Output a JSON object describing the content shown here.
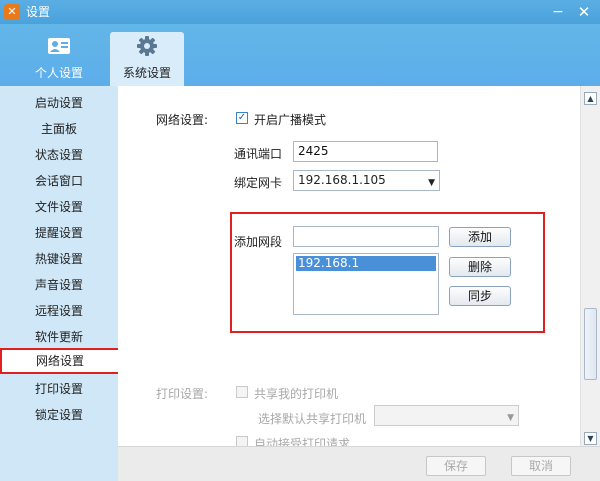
{
  "window": {
    "app_icon": "✕",
    "title": "设置",
    "minimize": "−",
    "close": "✕"
  },
  "top_tabs": [
    {
      "label": "个人设置",
      "icon": "person-card-icon",
      "selected": false
    },
    {
      "label": "系统设置",
      "icon": "gear-icon",
      "selected": true
    }
  ],
  "sidebar": {
    "items": [
      {
        "label": "启动设置"
      },
      {
        "label": "主面板"
      },
      {
        "label": "状态设置"
      },
      {
        "label": "会话窗口"
      },
      {
        "label": "文件设置"
      },
      {
        "label": "提醒设置"
      },
      {
        "label": "热键设置"
      },
      {
        "label": "声音设置"
      },
      {
        "label": "远程设置"
      },
      {
        "label": "软件更新"
      },
      {
        "label": "网络设置",
        "active": true
      },
      {
        "label": "打印设置"
      },
      {
        "label": "锁定设置"
      }
    ]
  },
  "network": {
    "section_label": "网络设置:",
    "broadcast_checkbox": {
      "checked": true,
      "label": "开启广播模式",
      "mark": "✓"
    },
    "port_label": "通讯端口",
    "port_value": "2425",
    "nic_label": "绑定网卡",
    "nic_value": "192.168.1.105",
    "segment_label": "添加网段",
    "segment_input_value": "",
    "segments": [
      "192.168.1"
    ],
    "add_button": "添加",
    "delete_button": "删除",
    "sync_button": "同步"
  },
  "print": {
    "section_label": "打印设置:",
    "share_checkbox": {
      "checked": false,
      "label": "共享我的打印机"
    },
    "default_printer_label": "选择默认共享打印机",
    "default_printer_value": "",
    "auto_accept_checkbox": {
      "checked": false,
      "label": "自动接受打印请求"
    }
  },
  "footer": {
    "save": "保存",
    "cancel": "取消"
  },
  "scroll": {
    "up_arrow": "▲",
    "down_arrow": "▼"
  },
  "colors": {
    "accent": "#4aa2dc",
    "sidebar_bg": "#cfe7f7",
    "highlight_border": "#e02020",
    "selection": "#4a90d9"
  }
}
